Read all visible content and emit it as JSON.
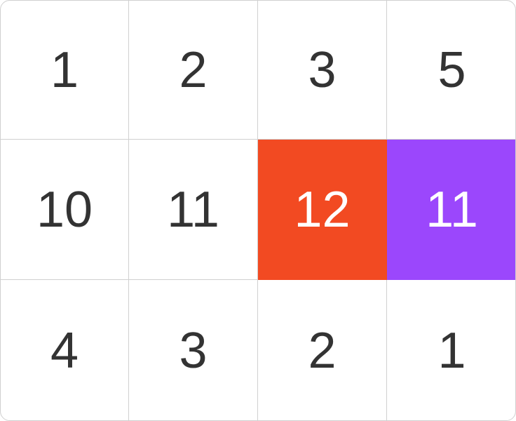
{
  "board": {
    "rows": 3,
    "cols": 4,
    "cells": [
      {
        "value": "1"
      },
      {
        "value": "2"
      },
      {
        "value": "3"
      },
      {
        "value": "5"
      },
      {
        "value": "10"
      },
      {
        "value": "11"
      },
      {
        "value": "12",
        "bg": "#f24a22"
      },
      {
        "value": "11",
        "bg": "#9b47fc"
      },
      {
        "value": "4"
      },
      {
        "value": "3"
      },
      {
        "value": "2"
      },
      {
        "value": "1"
      }
    ]
  },
  "colors": {
    "text": "#333333",
    "highlight_text": "#ffffff",
    "grid_line": "#d0d0d0"
  }
}
